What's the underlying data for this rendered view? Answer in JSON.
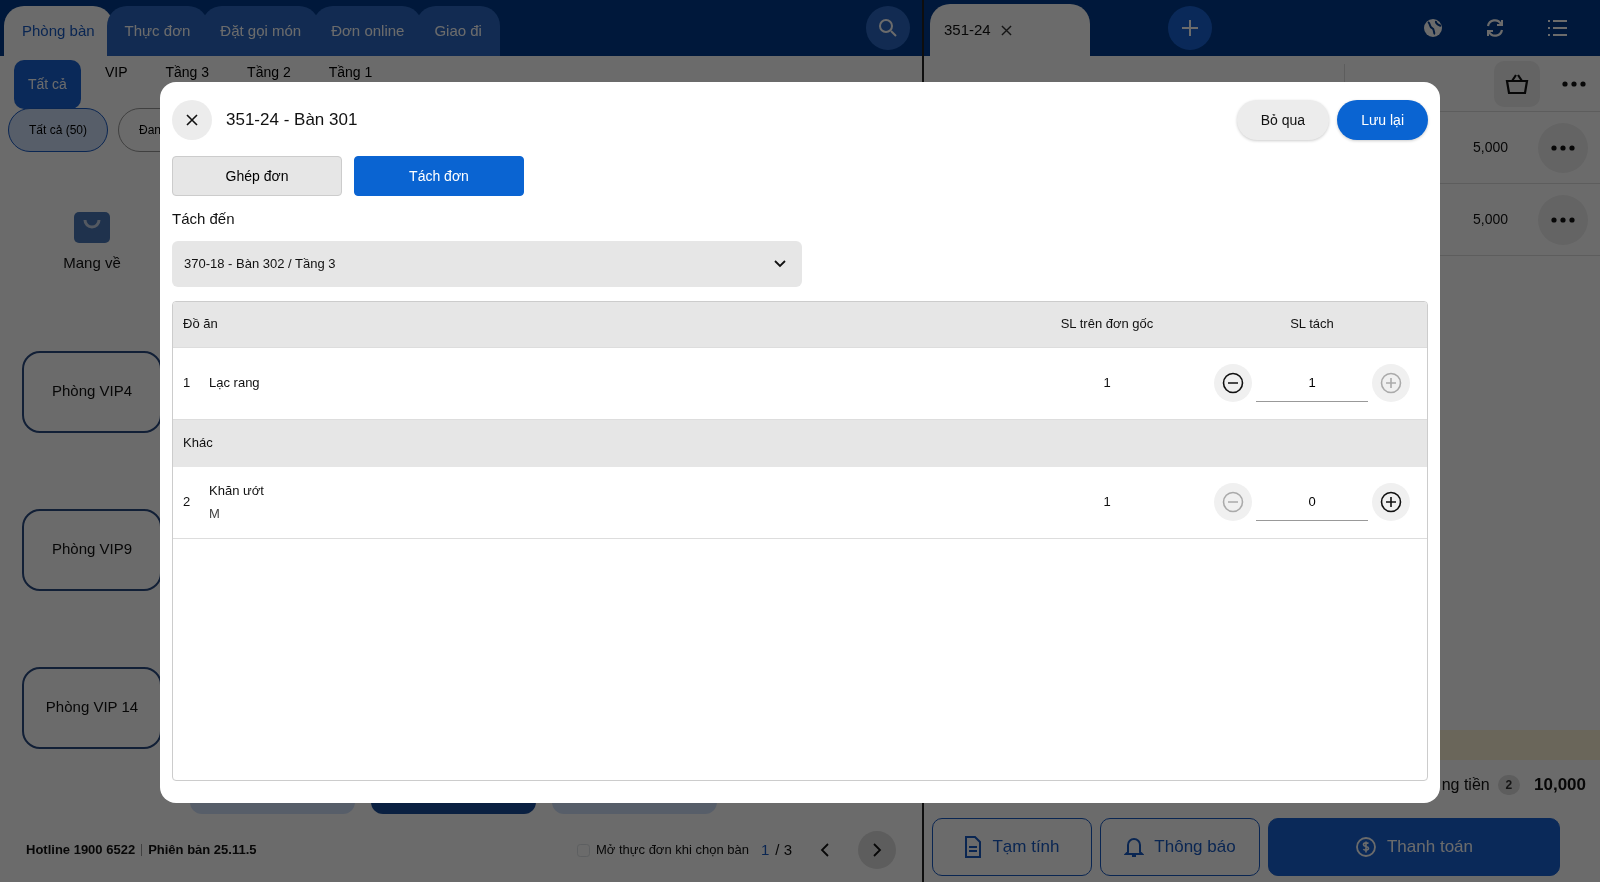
{
  "left_tabs": [
    {
      "label": "Phòng bàn",
      "selected": true
    },
    {
      "label": "Thực đơn",
      "selected": false
    },
    {
      "label": "Đặt gọi món",
      "selected": false
    },
    {
      "label": "Đơn online",
      "selected": false
    },
    {
      "label": "Giao đi",
      "selected": false
    }
  ],
  "floor_filters": [
    {
      "label": "Tất cả",
      "selected": true
    },
    {
      "label": "VIP",
      "selected": false
    },
    {
      "label": "Tầng 3",
      "selected": false
    },
    {
      "label": "Tầng 2",
      "selected": false
    },
    {
      "label": "Tầng 1",
      "selected": false
    }
  ],
  "status_pills": [
    {
      "label": "Tất cả (50)",
      "selected": true
    },
    {
      "label": "Đan",
      "selected": false
    }
  ],
  "takeaway": {
    "label": "Mang về"
  },
  "tables": [
    {
      "label": "Phòng VIP4"
    },
    {
      "label": "Phòng VIP9"
    },
    {
      "label": "Phòng VIP 14"
    }
  ],
  "footer": {
    "hotline": "Hotline 1900 6522",
    "version": "Phiên bản 25.11.5",
    "open_menu": {
      "label": "Mở thực đơn khi chọn bàn",
      "checked": false
    },
    "page_current": "1",
    "page_total": "/ 3"
  },
  "order_tabs": [
    {
      "label": "351-24",
      "selected": true
    }
  ],
  "order_lines": [
    {
      "price": "5,000"
    },
    {
      "price": "5,000"
    }
  ],
  "total": {
    "label": "ng tiền",
    "count": "2",
    "amount": "10,000"
  },
  "actions": [
    {
      "label": "Tạm tính",
      "kind": "draft"
    },
    {
      "label": "Thông báo",
      "kind": "notify"
    },
    {
      "label": "Thanh toán",
      "kind": "pay"
    }
  ],
  "dialog": {
    "title": "351-24 - Bàn 301",
    "buttons": [
      {
        "label": "Bỏ qua",
        "kind": "secondary"
      },
      {
        "label": "Lưu lại",
        "kind": "primary"
      }
    ],
    "modes": [
      {
        "label": "Ghép đơn",
        "selected": false
      },
      {
        "label": "Tách đơn",
        "selected": true
      }
    ],
    "target_label": "Tách đến",
    "target_value": "370-18 - Bàn 302 / Tầng 3",
    "columns": [
      "Đồ ăn",
      "SL trên đơn gốc",
      "SL tách"
    ],
    "rows": [
      {
        "kind": "item",
        "index": "1",
        "name": "Lạc rang",
        "original_qty": "1",
        "split_qty": "1",
        "minus_disabled": false,
        "plus_disabled": true
      },
      {
        "kind": "group",
        "name": "Khác"
      },
      {
        "kind": "item",
        "index": "2",
        "name": "Khăn ướt",
        "note": "M",
        "original_qty": "1",
        "split_qty": "0",
        "minus_disabled": true,
        "plus_disabled": false
      }
    ]
  }
}
